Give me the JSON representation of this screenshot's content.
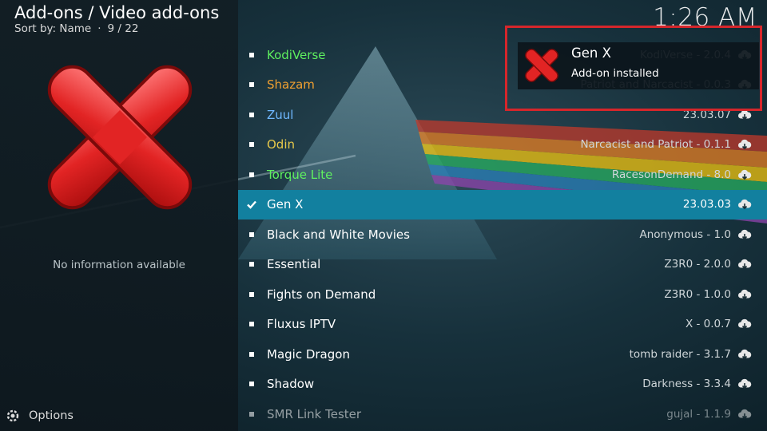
{
  "header": {
    "title": "Add-ons / Video add-ons",
    "sort_label": "Sort by: Name",
    "position": "9 / 22"
  },
  "clock": "1:26 AM",
  "info_panel": {
    "no_info": "No information available"
  },
  "options": {
    "label": "Options",
    "icon": "gear-icon"
  },
  "colors": {
    "selected_row": "#12809f",
    "green_name": "#5ff05f",
    "orange_name": "#f0a030",
    "highlight_border": "#d6262b"
  },
  "addons": [
    {
      "name": "KodiVerse",
      "version": "KodiVerse - 2.0.4",
      "color": "#5ff05f"
    },
    {
      "name": "Shazam",
      "version": "Patriot and Narcacist - 0.0.3",
      "color": "#f0a030"
    },
    {
      "name": "Zuul",
      "version": "23.03.07",
      "color": "#6fb8ff"
    },
    {
      "name": "Odin",
      "version": "Narcacist and Patriot - 0.1.1",
      "color": "#e6c84a"
    },
    {
      "name": "Torque Lite",
      "version": "RacesonDemand - 8.0",
      "color": "#5ff05f"
    },
    {
      "name": "Gen X",
      "version": "23.03.03",
      "color": "#ffffff",
      "selected": true
    },
    {
      "name": "Black and White Movies",
      "version": "Anonymous - 1.0",
      "color": "#ffffff"
    },
    {
      "name": "Essential",
      "version": "Z3R0 - 2.0.0",
      "color": "#ffffff"
    },
    {
      "name": "Fights on Demand",
      "version": "Z3R0 - 1.0.0",
      "color": "#ffffff"
    },
    {
      "name": "Fluxus IPTV",
      "version": "X - 0.0.7",
      "color": "#ffffff"
    },
    {
      "name": "Magic Dragon",
      "version": "tomb raider - 3.1.7",
      "color": "#ffffff"
    },
    {
      "name": "Shadow",
      "version": "Darkness - 3.3.4",
      "color": "#ffffff"
    },
    {
      "name": "SMR Link Tester",
      "version": "gujal - 1.1.9",
      "color": "#ffffff",
      "faded": true
    }
  ],
  "notification": {
    "title": "Gen X",
    "message": "Add-on installed",
    "icon": "red-x-icon"
  }
}
